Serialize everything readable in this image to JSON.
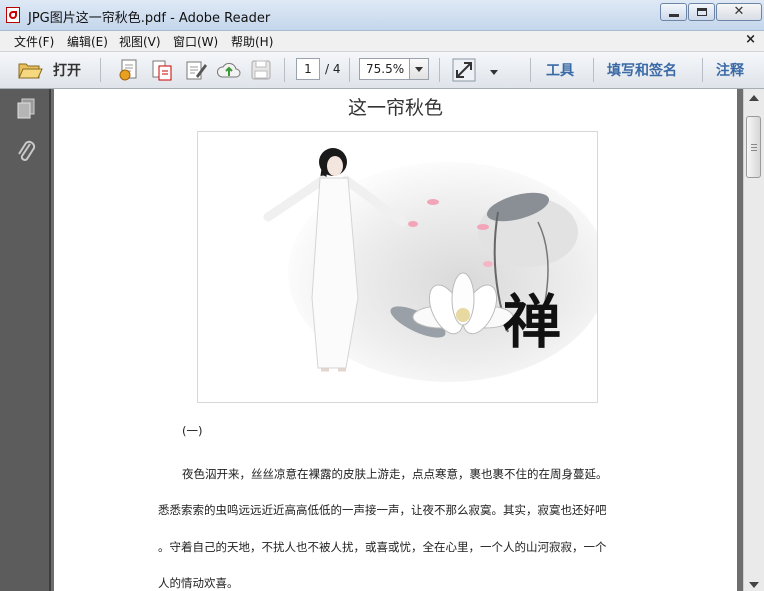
{
  "window": {
    "title": "JPG图片这一帘秋色.pdf - Adobe Reader",
    "minimize_icon": "minimize-icon",
    "maximize_icon": "maximize-icon",
    "close_glyph": "✕"
  },
  "menubar": {
    "items": [
      "文件(F)",
      "编辑(E)",
      "视图(V)",
      "窗口(W)",
      "帮助(H)"
    ],
    "close_glyph": "×"
  },
  "toolbar": {
    "open_label": "打开",
    "page_current": "1",
    "page_total": "/ 4",
    "zoom": "75.5%",
    "tools_label": "工具",
    "fill_sign_label": "填写和签名",
    "comment_label": "注释"
  },
  "document": {
    "title": "这一帘秋色",
    "section": "(一)",
    "paragraphs": [
      "夜色泅开来，丝丝凉意在裸露的皮肤上游走，点点寒意，裹也裹不住的在周身蔓延。",
      "悉悉索索的虫鸣远远近近高高低低的一声接一声，让夜不那么寂寞。其实，寂寞也还好吧",
      "。守着自己的天地，不扰人也不被人扰，或喜或忧，全在心里，一个人的山河寂寂，一个",
      "人的情动欢喜。"
    ],
    "calligraphy": "禅"
  },
  "colors": {
    "accent_link": "#3a6aa5",
    "page_bg": "#ffffff",
    "workspace_bg": "#6e6e6e"
  }
}
